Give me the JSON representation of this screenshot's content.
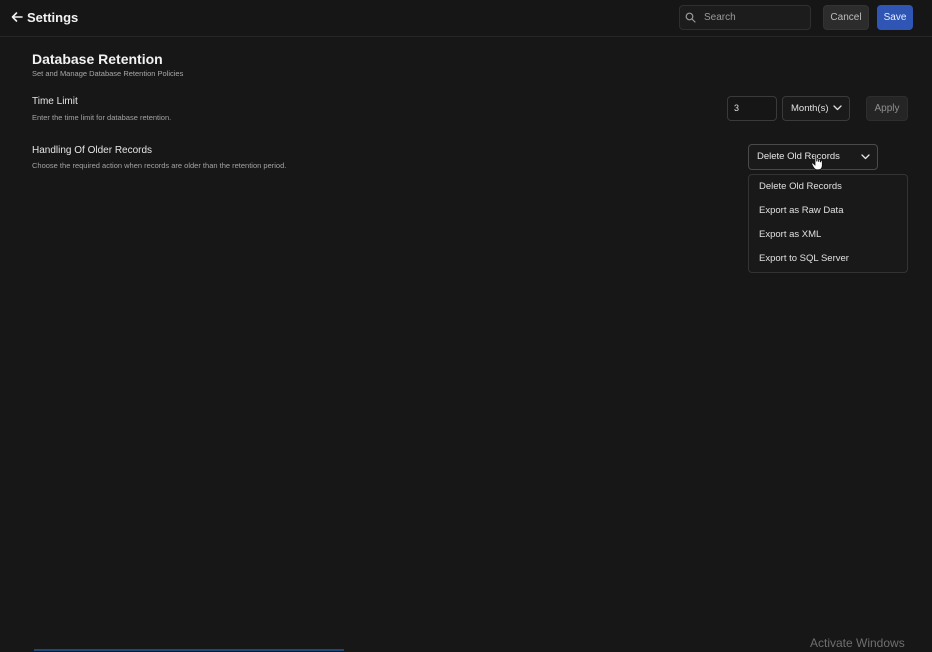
{
  "header": {
    "title": "Settings",
    "search_placeholder": "Search",
    "cancel_label": "Cancel",
    "save_label": "Save"
  },
  "section": {
    "title": "Database Retention",
    "subtitle": "Set and Manage Database Retention Policies"
  },
  "time_limit": {
    "label": "Time Limit",
    "description": "Enter the time limit for database retention.",
    "value": "3",
    "unit": "Month(s)",
    "apply_label": "Apply"
  },
  "older_records": {
    "label": "Handling Of Older Records",
    "description": "Choose the required action when records are older than the retention period.",
    "selected": "Delete Old Records",
    "options": [
      "Delete Old Records",
      "Export as Raw Data",
      "Export as XML",
      "Export to SQL Server"
    ]
  },
  "watermark": "Activate Windows",
  "colors": {
    "background": "#171717",
    "accent": "#2f55b5"
  }
}
